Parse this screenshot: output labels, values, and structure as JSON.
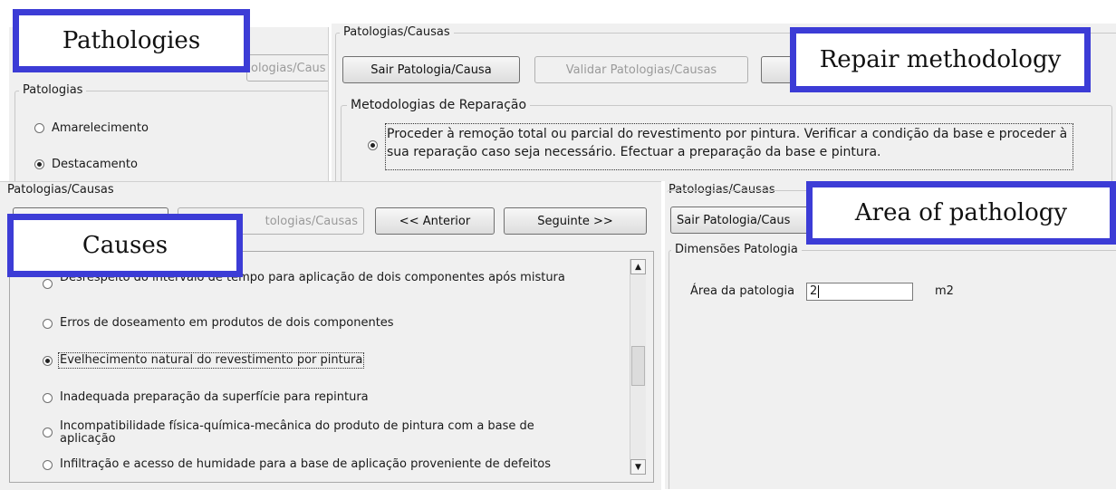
{
  "pathologies_panel": {
    "hidden_button_fragment": "ologias/Caus",
    "group_title": "Patologias",
    "options": [
      {
        "label": "Amarelecimento",
        "checked": false
      },
      {
        "label": "Destacamento",
        "checked": true
      }
    ]
  },
  "repair_panel": {
    "title": "Patologias/Causas",
    "exit_button": "Sair Patologia/Causa",
    "validate_button": "Validar Patologias/Causas",
    "group_title": "Metodologias de Reparação",
    "method_text": "Proceder à remoção total ou parcial do revestimento por pintura. Verificar a condição da base e proceder à sua reparação caso seja necessário. Efectuar a preparação da base e pintura."
  },
  "causes_panel": {
    "title": "Patologias/Causas",
    "validate_fragment": "tologias/Causas",
    "previous_button": "<< Anterior",
    "next_button": "Seguinte >>",
    "causes": [
      {
        "label": "Desrespeito do intervalo de tempo para aplicação de dois componentes após mistura",
        "checked": false
      },
      {
        "label": "Erros de doseamento em produtos de dois componentes",
        "checked": false
      },
      {
        "label": "Evelhecimento natural do revestimento por pintura",
        "checked": true
      },
      {
        "label": "Inadequada preparação da superfície para repintura",
        "checked": false
      },
      {
        "label": "Incompatibilidade física-química-mecânica do produto de pintura com a base de aplicação",
        "checked": false
      },
      {
        "label": "Infiltração e acesso de humidade para a base de aplicação proveniente de defeitos",
        "checked": false
      }
    ]
  },
  "area_panel": {
    "title": "Patologias/Causas",
    "exit_button_fragment": "Sair Patologia/Caus",
    "group_title": "Dimensões Patologia",
    "area_label": "Área da patologia",
    "area_value": "2",
    "unit": "m2"
  },
  "overlay_labels": {
    "pathologies": "Pathologies",
    "repair": "Repair methodology",
    "causes": "Causes",
    "area": "Area of pathology"
  },
  "colors": {
    "overlay_border": "#3c3cd6",
    "window_bg": "#f0f0f0"
  },
  "icons": [
    "radio-button",
    "scroll-up-arrow",
    "scroll-down-arrow"
  ]
}
